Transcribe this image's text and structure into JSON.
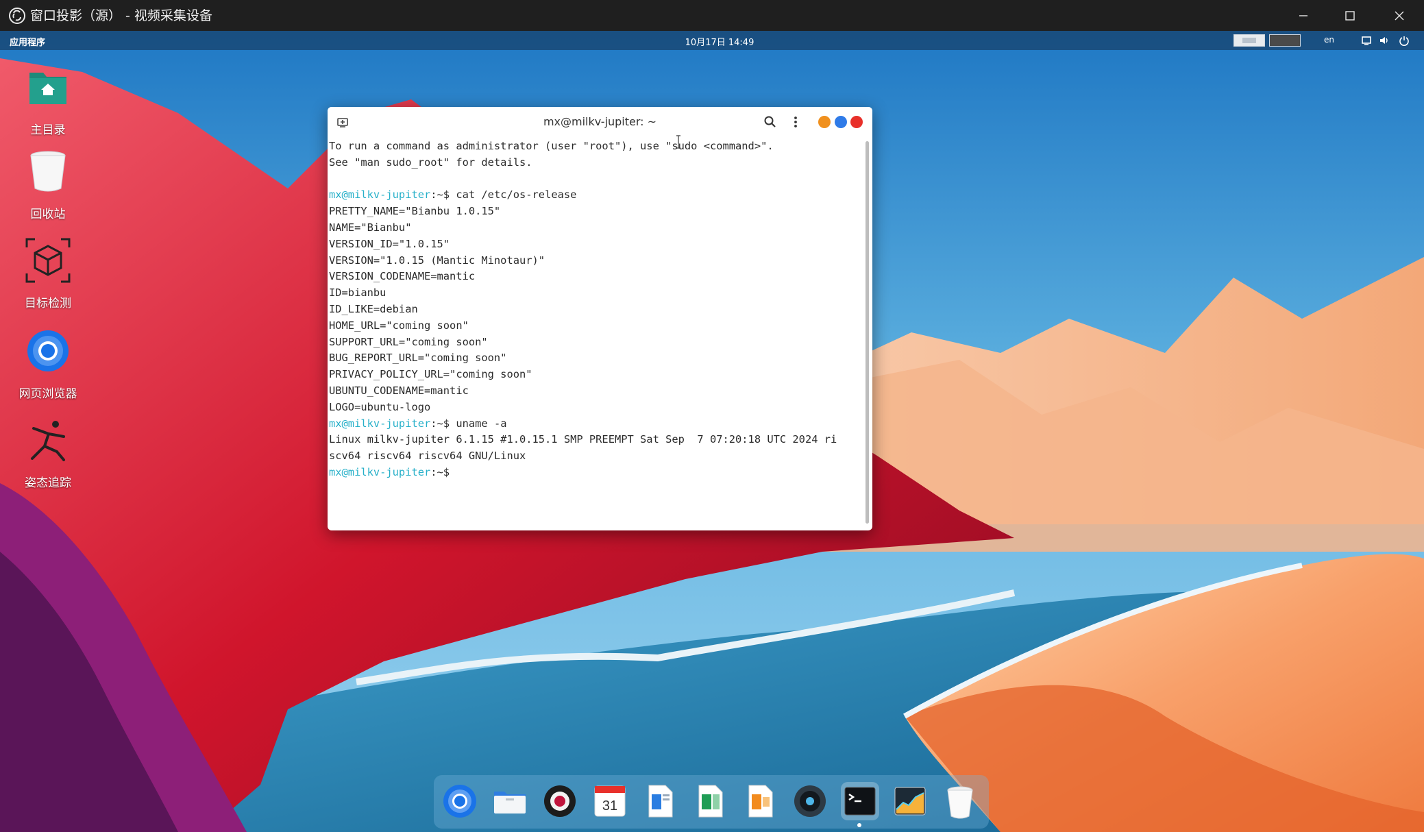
{
  "host_window": {
    "title": "窗口投影（源） - 视频采集设备",
    "app_icon": "obs-icon",
    "controls": [
      "minimize-icon",
      "maximize-icon",
      "close-icon"
    ]
  },
  "top_panel": {
    "apps_menu": "应用程序",
    "clock": "10月17日 14:49",
    "language": "en",
    "tray_icons": [
      "display-icon",
      "volume-icon",
      "power-icon"
    ]
  },
  "desktop_icons": [
    {
      "label": "主目录",
      "icon": "home-folder-icon"
    },
    {
      "label": "回收站",
      "icon": "trash-icon"
    },
    {
      "label": "目标检测",
      "icon": "object-detection-icon"
    },
    {
      "label": "网页浏览器",
      "icon": "browser-icon"
    },
    {
      "label": "姿态追踪",
      "icon": "pose-tracking-icon"
    }
  ],
  "terminal": {
    "title": "mx@milkv-jupiter: ~",
    "prompt": "mx@milkv-jupiter",
    "lines": [
      {
        "text": "To run a command as administrator (user \"root\"), use \"sudo <command>\"."
      },
      {
        "text": "See \"man sudo_root\" for details."
      },
      {
        "text": ""
      },
      {
        "prompt": "mx@milkv-jupiter",
        "suffix": ":~$ ",
        "text": "cat /etc/os-release"
      },
      {
        "text": "PRETTY_NAME=\"Bianbu 1.0.15\""
      },
      {
        "text": "NAME=\"Bianbu\""
      },
      {
        "text": "VERSION_ID=\"1.0.15\""
      },
      {
        "text": "VERSION=\"1.0.15 (Mantic Minotaur)\""
      },
      {
        "text": "VERSION_CODENAME=mantic"
      },
      {
        "text": "ID=bianbu"
      },
      {
        "text": "ID_LIKE=debian"
      },
      {
        "text": "HOME_URL=\"coming soon\""
      },
      {
        "text": "SUPPORT_URL=\"coming soon\""
      },
      {
        "text": "BUG_REPORT_URL=\"coming soon\""
      },
      {
        "text": "PRIVACY_POLICY_URL=\"coming soon\""
      },
      {
        "text": "UBUNTU_CODENAME=mantic"
      },
      {
        "text": "LOGO=ubuntu-logo"
      },
      {
        "prompt": "mx@milkv-jupiter",
        "suffix": ":~$ ",
        "text": "uname -a"
      },
      {
        "text": "Linux milkv-jupiter 6.1.15 #1.0.15.1 SMP PREEMPT Sat Sep  7 07:20:18 UTC 2024 ri"
      },
      {
        "text": "scv64 riscv64 riscv64 GNU/Linux"
      },
      {
        "prompt": "mx@milkv-jupiter",
        "suffix": ":~$",
        "text": ""
      }
    ],
    "window_dot_colors": [
      "#f0901e",
      "#2f7be8",
      "#e8302a"
    ]
  },
  "dock": {
    "items": [
      {
        "name": "browser",
        "icon": "chromium-icon"
      },
      {
        "name": "files",
        "icon": "file-manager-icon"
      },
      {
        "name": "media",
        "icon": "media-player-icon"
      },
      {
        "name": "calendar",
        "icon": "calendar-icon",
        "label": "31"
      },
      {
        "name": "writer",
        "icon": "document-icon"
      },
      {
        "name": "spreadsheet",
        "icon": "spreadsheet-icon"
      },
      {
        "name": "presentation",
        "icon": "presentation-icon"
      },
      {
        "name": "music",
        "icon": "music-player-icon"
      },
      {
        "name": "terminal",
        "icon": "terminal-icon",
        "active": true
      },
      {
        "name": "system-monitor",
        "icon": "system-monitor-icon"
      },
      {
        "name": "trash",
        "icon": "trash-icon"
      }
    ]
  },
  "colors": {
    "prompt": "#27b0c9",
    "terminal_bg": "#ffffff",
    "host_titlebar": "#1f1f1f"
  }
}
